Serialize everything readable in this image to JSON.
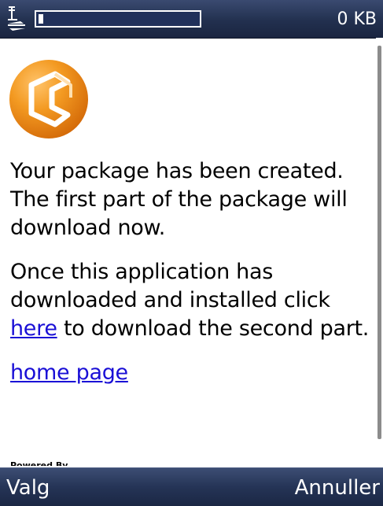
{
  "status_bar": {
    "signal_icon": "gprs-signal-icon",
    "download_progress_percent": 2,
    "downloaded_size": "0 KB"
  },
  "logo": {
    "icon": "orange-app-logo-icon",
    "colors": {
      "outer": "#f08a1a",
      "inner": "#ffffff"
    }
  },
  "main": {
    "paragraph_1": "Your package has been created. The first part of the package will download now.",
    "paragraph_2_before": "Once this application has downloaded and installed click ",
    "paragraph_2_link": "here",
    "paragraph_2_after": " to download the second part.",
    "home_link": "home page",
    "powered_by": "Powered By"
  },
  "softkeys": {
    "left": "Valg",
    "right": "Annuller"
  },
  "colors": {
    "bar_background": "#22304f",
    "link": "#1a0fd6",
    "text": "#000000"
  }
}
